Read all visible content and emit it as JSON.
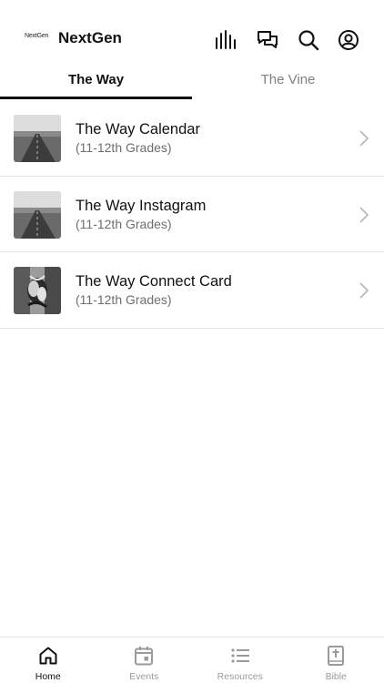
{
  "status_bar": {
    "text": ""
  },
  "header": {
    "logo_text": "NextGen",
    "title": "NextGen",
    "icons": [
      "stats-icon",
      "chat-icon",
      "search-icon",
      "profile-icon"
    ]
  },
  "tabs": [
    {
      "label": "The Way",
      "active": true
    },
    {
      "label": "The Vine",
      "active": false
    }
  ],
  "list": [
    {
      "title": "The Way Calendar",
      "subtitle": "(11-12th Grades)",
      "thumb": "road-image"
    },
    {
      "title": "The Way Instagram",
      "subtitle": "(11-12th Grades)",
      "thumb": "road-image"
    },
    {
      "title": "The Way Connect Card",
      "subtitle": "(11-12th Grades)",
      "thumb": "hands-image"
    }
  ],
  "bottom_nav": [
    {
      "label": "Home",
      "icon": "home-icon",
      "active": true
    },
    {
      "label": "Events",
      "icon": "calendar-icon",
      "active": false
    },
    {
      "label": "Resources",
      "icon": "list-icon",
      "active": false
    },
    {
      "label": "Bible",
      "icon": "bible-icon",
      "active": false
    }
  ],
  "colors": {
    "text": "#111111",
    "muted": "#6e6e6e",
    "inactive": "#9a9a9a",
    "divider": "#e4e4e4"
  }
}
